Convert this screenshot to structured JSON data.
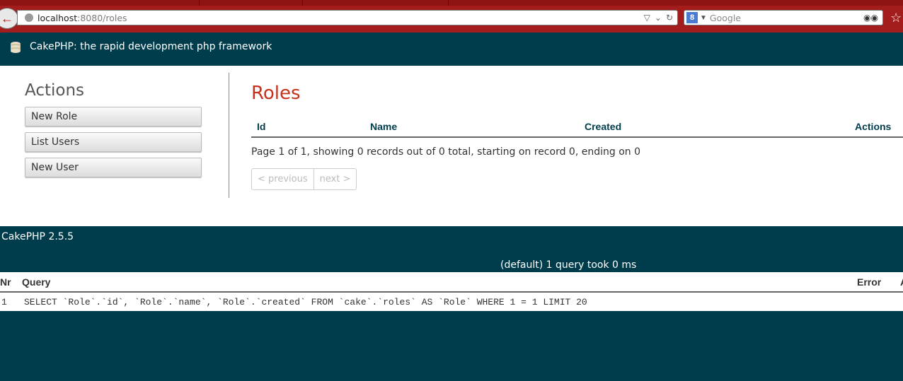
{
  "browser": {
    "url_host": "localhost",
    "url_path": ":8080/roles",
    "search_placeholder": "Google",
    "search_engine_letter": "8"
  },
  "header": {
    "title": "CakePHP: the rapid development php framework"
  },
  "sidebar": {
    "heading": "Actions",
    "buttons": [
      {
        "label": "New Role"
      },
      {
        "label": "List Users"
      },
      {
        "label": "New User"
      }
    ]
  },
  "main": {
    "title": "Roles",
    "columns": [
      "Id",
      "Name",
      "Created",
      "Actions"
    ],
    "paging_text": "Page 1 of 1, showing 0 records out of 0 total, starting on record 0, ending on 0",
    "prev_label": "< previous",
    "next_label": "next >"
  },
  "footer": {
    "version": "CakePHP 2.5.5"
  },
  "sql_log": {
    "caption": "(default) 1 query took 0 ms",
    "columns": [
      "Nr",
      "Query",
      "Error",
      "A"
    ],
    "rows": [
      {
        "nr": "1",
        "query": "SELECT `Role`.`id`, `Role`.`name`, `Role`.`created` FROM `cake`.`roles` AS `Role` WHERE 1 = 1 LIMIT 20"
      }
    ]
  },
  "colors": {
    "brand_dark": "#003d4c",
    "title_red": "#c6311c",
    "browser_red": "#a41c1c"
  }
}
